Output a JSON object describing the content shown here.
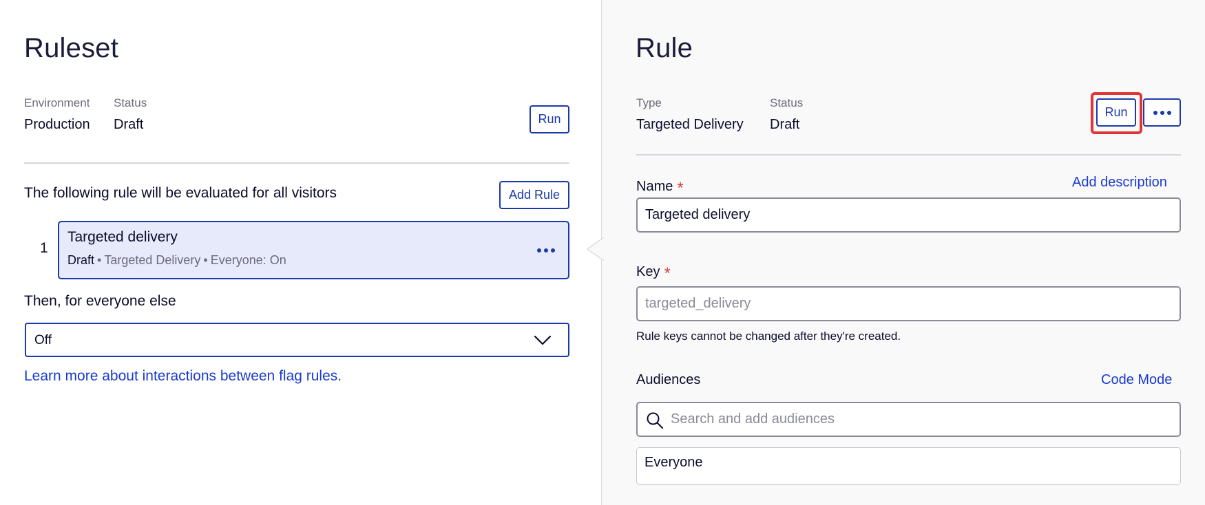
{
  "ruleset": {
    "title": "Ruleset",
    "environment_label": "Environment",
    "environment_value": "Production",
    "status_label": "Status",
    "status_value": "Draft",
    "run_label": "Run",
    "evaluation_text": "The following rule will be evaluated for all visitors",
    "add_rule_label": "Add Rule",
    "rules": [
      {
        "index": "1",
        "name": "Targeted delivery",
        "status": "Draft",
        "type": "Targeted Delivery",
        "audience": "Everyone: On"
      }
    ],
    "fallback_label": "Then, for everyone else",
    "fallback_value": "Off",
    "learn_more_link": "Learn more about interactions between flag rules."
  },
  "rule": {
    "title": "Rule",
    "type_label": "Type",
    "type_value": "Targeted Delivery",
    "status_label": "Status",
    "status_value": "Draft",
    "run_label": "Run",
    "name_label": "Name",
    "required_mark": "*",
    "add_description_link": "Add description",
    "name_value": "Targeted delivery",
    "key_label": "Key",
    "key_placeholder": "targeted_delivery",
    "key_help": "Rule keys cannot be changed after they're created.",
    "audiences_label": "Audiences",
    "code_mode_link": "Code Mode",
    "audience_search_placeholder": "Search and add audiences",
    "audiences": [
      "Everyone"
    ]
  },
  "colors": {
    "accent": "#1a3aa8",
    "link": "#1a3ad0",
    "selected_rule_bg": "#e6eafb",
    "required": "#d63b3b",
    "highlight": "#e23434",
    "right_panel_bg": "#f9f9fa"
  },
  "icons": [
    "more-icon",
    "chevron-down-icon",
    "search-icon"
  ]
}
